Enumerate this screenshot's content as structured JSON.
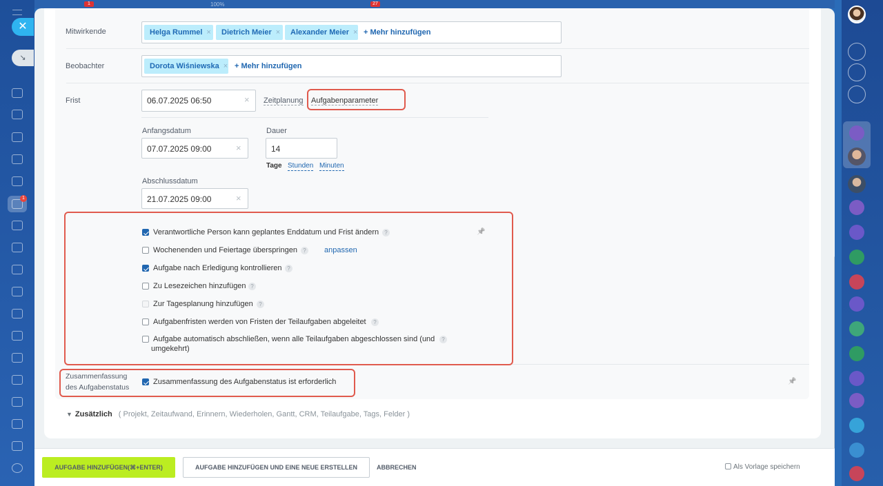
{
  "topbar": {
    "badge1": "1",
    "zoom": "100%",
    "badge2": "27"
  },
  "leftnav": {
    "close_icon": "✕",
    "minimize_icon": "↘",
    "tasks_badge": "1"
  },
  "form": {
    "participants": {
      "label": "Mitwirkende",
      "tags": [
        "Helga Rummel",
        "Dietrich Meier",
        "Alexander Meier"
      ],
      "more": "+ Mehr hinzufügen"
    },
    "observers": {
      "label": "Beobachter",
      "tags": [
        "Dorota Wiśniewska"
      ],
      "more": "+ Mehr hinzufügen"
    },
    "deadline": {
      "label": "Frist",
      "value": "06.07.2025 06:50",
      "planning_label": "Zeitplanung",
      "params_link": "Aufgabenparameter"
    },
    "start": {
      "label": "Anfangsdatum",
      "value": "07.07.2025 09:00"
    },
    "duration": {
      "label": "Dauer",
      "value": "14",
      "units": [
        "Tage",
        "Stunden",
        "Minuten"
      ]
    },
    "end": {
      "label": "Abschlussdatum",
      "value": "21.07.2025 09:00"
    },
    "options": [
      {
        "label": "Verantwortliche Person kann geplantes Enddatum und Frist ändern",
        "checked": true
      },
      {
        "label": "Wochenenden und Feiertage überspringen",
        "checked": false,
        "link": "anpassen"
      },
      {
        "label": "Aufgabe nach Erledigung kontrollieren",
        "checked": true
      },
      {
        "label": "Zu Lesezeichen hinzufügen",
        "checked": false
      },
      {
        "label": "Zur Tagesplanung hinzufügen",
        "checked": false,
        "disabled": true
      },
      {
        "label": "Aufgabenfristen werden von Fristen der Teilaufgaben abgeleitet",
        "checked": false
      },
      {
        "label": "Aufgabe automatisch abschließen, wenn alle Teilaufgaben abgeschlossen sind (und",
        "label2": "umgekehrt)",
        "checked": false
      }
    ],
    "summary": {
      "label1": "Zusammenfassung",
      "label2": "des Aufgabenstatus",
      "option": "Zusammenfassung des Aufgabenstatus ist erforderlich",
      "checked": true
    },
    "help_glyph": "?",
    "clear_glyph": "×",
    "pin_glyph": "📌"
  },
  "additional": {
    "title": "Zusätzlich",
    "items": [
      "Projekt",
      "Zeitaufwand",
      "Erinnern",
      "Wiederholen",
      "Gantt",
      "CRM",
      "Teilaufgabe",
      "Tags",
      "Felder"
    ]
  },
  "footer": {
    "add_button": "AUFGABE HINZUFÜGEN(⌘+ENTER)",
    "add_new_button": "AUFGABE HINZUFÜGEN UND EINE NEUE ERSTELLEN",
    "cancel_button": "ABBRECHEN",
    "template_label": "Als Vorlage speichern"
  },
  "colors": {
    "accent": "#2067b0",
    "tag_bg": "#bcedfc",
    "primary_button": "#bbed21",
    "highlight": "#e05a4d"
  }
}
